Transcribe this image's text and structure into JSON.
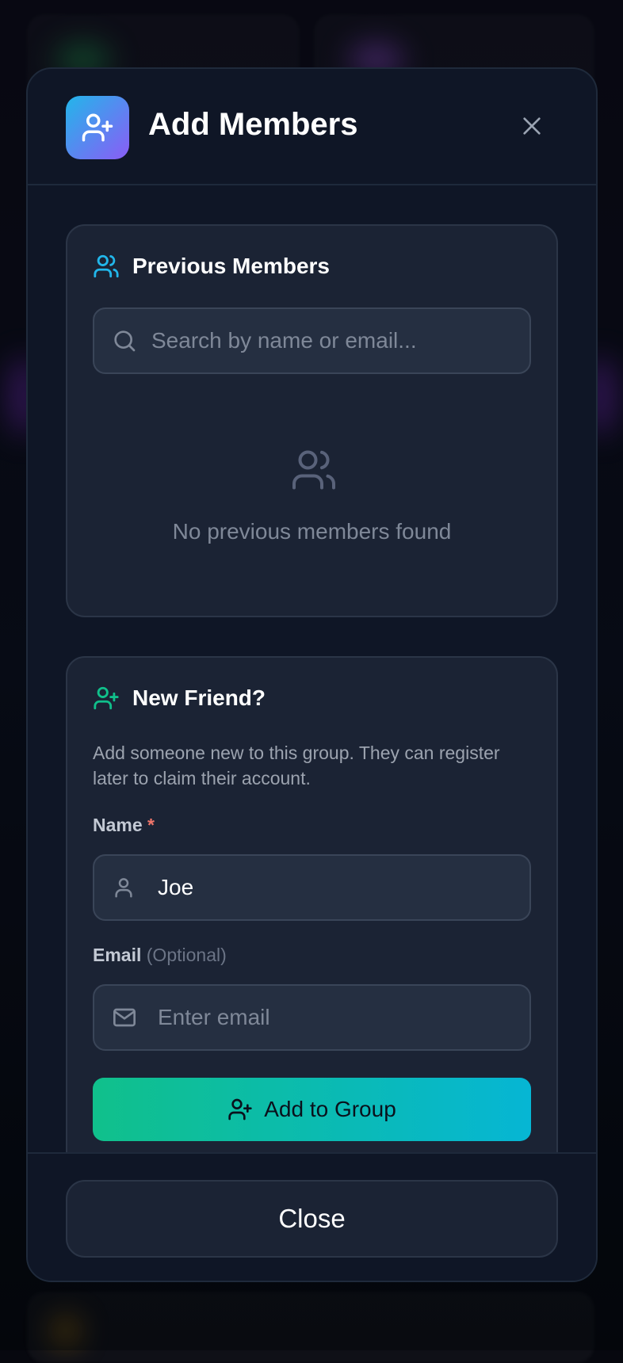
{
  "modal": {
    "title": "Add Members",
    "header_icon": "user-plus-icon",
    "close_icon": "close-icon"
  },
  "previous_members": {
    "title": "Previous Members",
    "icon": "users-icon",
    "search_placeholder": "Search by name or email...",
    "empty_text": "No previous members found"
  },
  "new_friend": {
    "title": "New Friend?",
    "icon": "user-plus-icon",
    "description": "Add someone new to this group. They can register later to claim their account.",
    "name_label": "Name",
    "name_required_mark": "*",
    "name_value": "Joe",
    "email_label": "Email",
    "email_optional": "(Optional)",
    "email_placeholder": "Enter email",
    "add_button_label": "Add to Group"
  },
  "footer": {
    "close_label": "Close"
  },
  "colors": {
    "accent_cyan": "#22b6ea",
    "accent_violet": "#8b5cf6",
    "accent_green": "#10c08b",
    "required_red": "#f0766b"
  }
}
